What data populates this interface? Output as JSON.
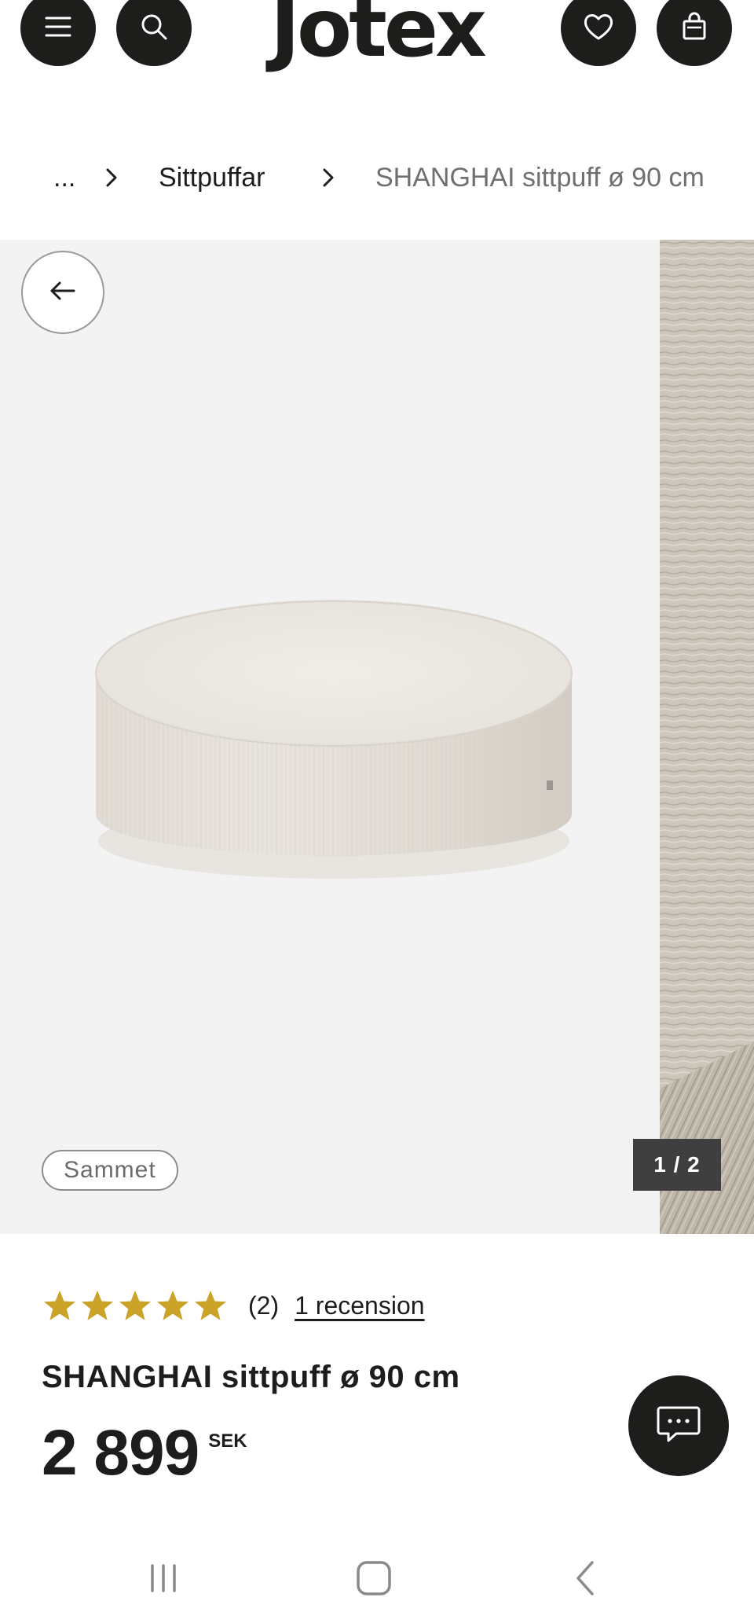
{
  "header": {
    "logo": "Jotex",
    "icons": [
      "menu-icon",
      "search-icon",
      "heart-icon",
      "shopping-bag-icon"
    ]
  },
  "breadcrumb": {
    "ellipsis": "...",
    "category": "Sittpuffar",
    "current": "SHANGHAI sittpuff ø 90 cm"
  },
  "gallery": {
    "tag": "Sammet",
    "counter": "1 / 2"
  },
  "product": {
    "rating_stars": 5,
    "rating_count": "(2)",
    "review_link": "1 recension",
    "title": "SHANGHAI sittpuff ø 90 cm",
    "price": "2 899",
    "currency": "SEK"
  },
  "colors": {
    "primary": "#1d1d1b",
    "star": "#c9a227",
    "gallery_bg": "#f3f3f3",
    "muted_text": "#6f6f6f"
  }
}
